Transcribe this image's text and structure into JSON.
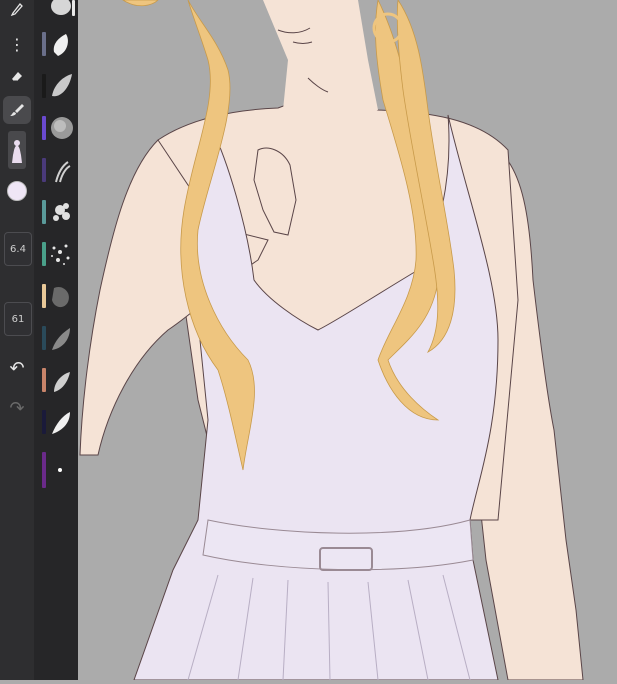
{
  "toolbar": {
    "more_icon": "⋮",
    "eraser_icon": "eraser-icon",
    "brush_icon": "brush-icon",
    "current_color": "#efe6f6",
    "brush_size": "6.4",
    "opacity": "61",
    "undo_icon": "↶",
    "redo_icon": "↷"
  },
  "brushes": [
    {
      "swatch": "#e8e8e8"
    },
    {
      "swatch": "#6a6f8a"
    },
    {
      "swatch": "#1a1a1a"
    },
    {
      "swatch": "#6a4ad0"
    },
    {
      "swatch": "#4a3a7a"
    },
    {
      "swatch": "#5a9a9a"
    },
    {
      "swatch": "#4aa08a"
    },
    {
      "swatch": "#e8c898"
    },
    {
      "swatch": "#2a4a5a"
    },
    {
      "swatch": "#c8846a"
    },
    {
      "swatch": "#1a1a3a"
    },
    {
      "swatch": "#6a2a8a"
    }
  ],
  "palette": {
    "skin": "#f5e3d6",
    "dress": "#ebe4f2",
    "hair": "#eec57f",
    "line": "#5a4548",
    "background": "#ababab"
  }
}
